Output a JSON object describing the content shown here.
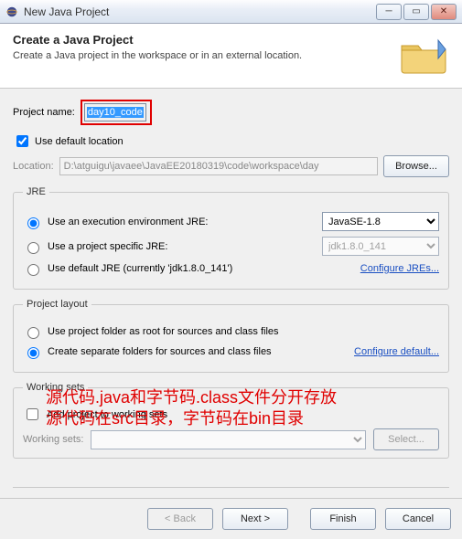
{
  "window": {
    "title": "New Java Project"
  },
  "banner": {
    "heading": "Create a Java Project",
    "subheading": "Create a Java project in the workspace or in an external location."
  },
  "projectName": {
    "label": "Project name:",
    "value": "day10_code"
  },
  "useDefaultLocation": {
    "label": "Use default location",
    "checked": true
  },
  "location": {
    "label": "Location:",
    "value": "D:\\atguigu\\javaee\\JavaEE20180319\\code\\workspace\\day",
    "browse": "Browse..."
  },
  "jre": {
    "legend": "JRE",
    "execEnv": {
      "label": "Use an execution environment JRE:",
      "value": "JavaSE-1.8"
    },
    "projectSpecific": {
      "label": "Use a project specific JRE:",
      "value": "jdk1.8.0_141"
    },
    "defaultJre": {
      "label": "Use default JRE (currently 'jdk1.8.0_141')"
    },
    "configure": "Configure JREs..."
  },
  "layout": {
    "legend": "Project layout",
    "root": "Use project folder as root for sources and class files",
    "separate": "Create separate folders for sources and class files",
    "configure": "Configure default..."
  },
  "workingSets": {
    "legend": "Working sets",
    "add": "Add project to working sets",
    "label": "Working sets:",
    "select": "Select..."
  },
  "actions": {
    "back": "< Back",
    "next": "Next >",
    "finish": "Finish",
    "cancel": "Cancel"
  },
  "annotation": {
    "line1": "源代码.java和字节码.class文件分开存放",
    "line2": "源代码在src目录，字节码在bin目录"
  }
}
